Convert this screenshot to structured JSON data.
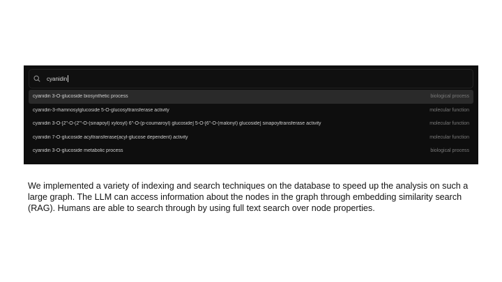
{
  "search": {
    "query": "cyanidin",
    "icon": "search-icon"
  },
  "results": [
    {
      "label": "cyanidin 3-O-glucoside biosynthetic process",
      "category": "biological process",
      "selected": true
    },
    {
      "label": "cyanidin-3-rhamnosylglucoside 5-O-glucosyltransferase activity",
      "category": "molecular function",
      "selected": false
    },
    {
      "label": "cyanidin 3-O-[2\"-O-(2\"'-O-(sinapoyl) xylosyl) 6\"-O-(p-coumaroyl) glucoside] 5-O-[6\"-O-(malonyl) glucoside] sinapoyltransferase activity",
      "category": "molecular function",
      "selected": false
    },
    {
      "label": "cyanidin 7-O-glucoside acyltransferase(acyl-glucose dependent) activity",
      "category": "molecular function",
      "selected": false
    },
    {
      "label": "cyanidin 3-O-glucoside metabolic process",
      "category": "biological process",
      "selected": false
    }
  ],
  "caption": "We implemented a variety of indexing and search techniques on the database to speed up the analysis on such a large graph. The LLM can access information about the nodes in the graph through embedding similarity search (RAG). Humans are able to search through by using full text search over node properties.",
  "colors": {
    "panel_bg": "#0e0e0e",
    "selected_row_bg": "#2a2a2a",
    "label_text": "#cfcfcf",
    "category_text": "#7a7a7a"
  }
}
